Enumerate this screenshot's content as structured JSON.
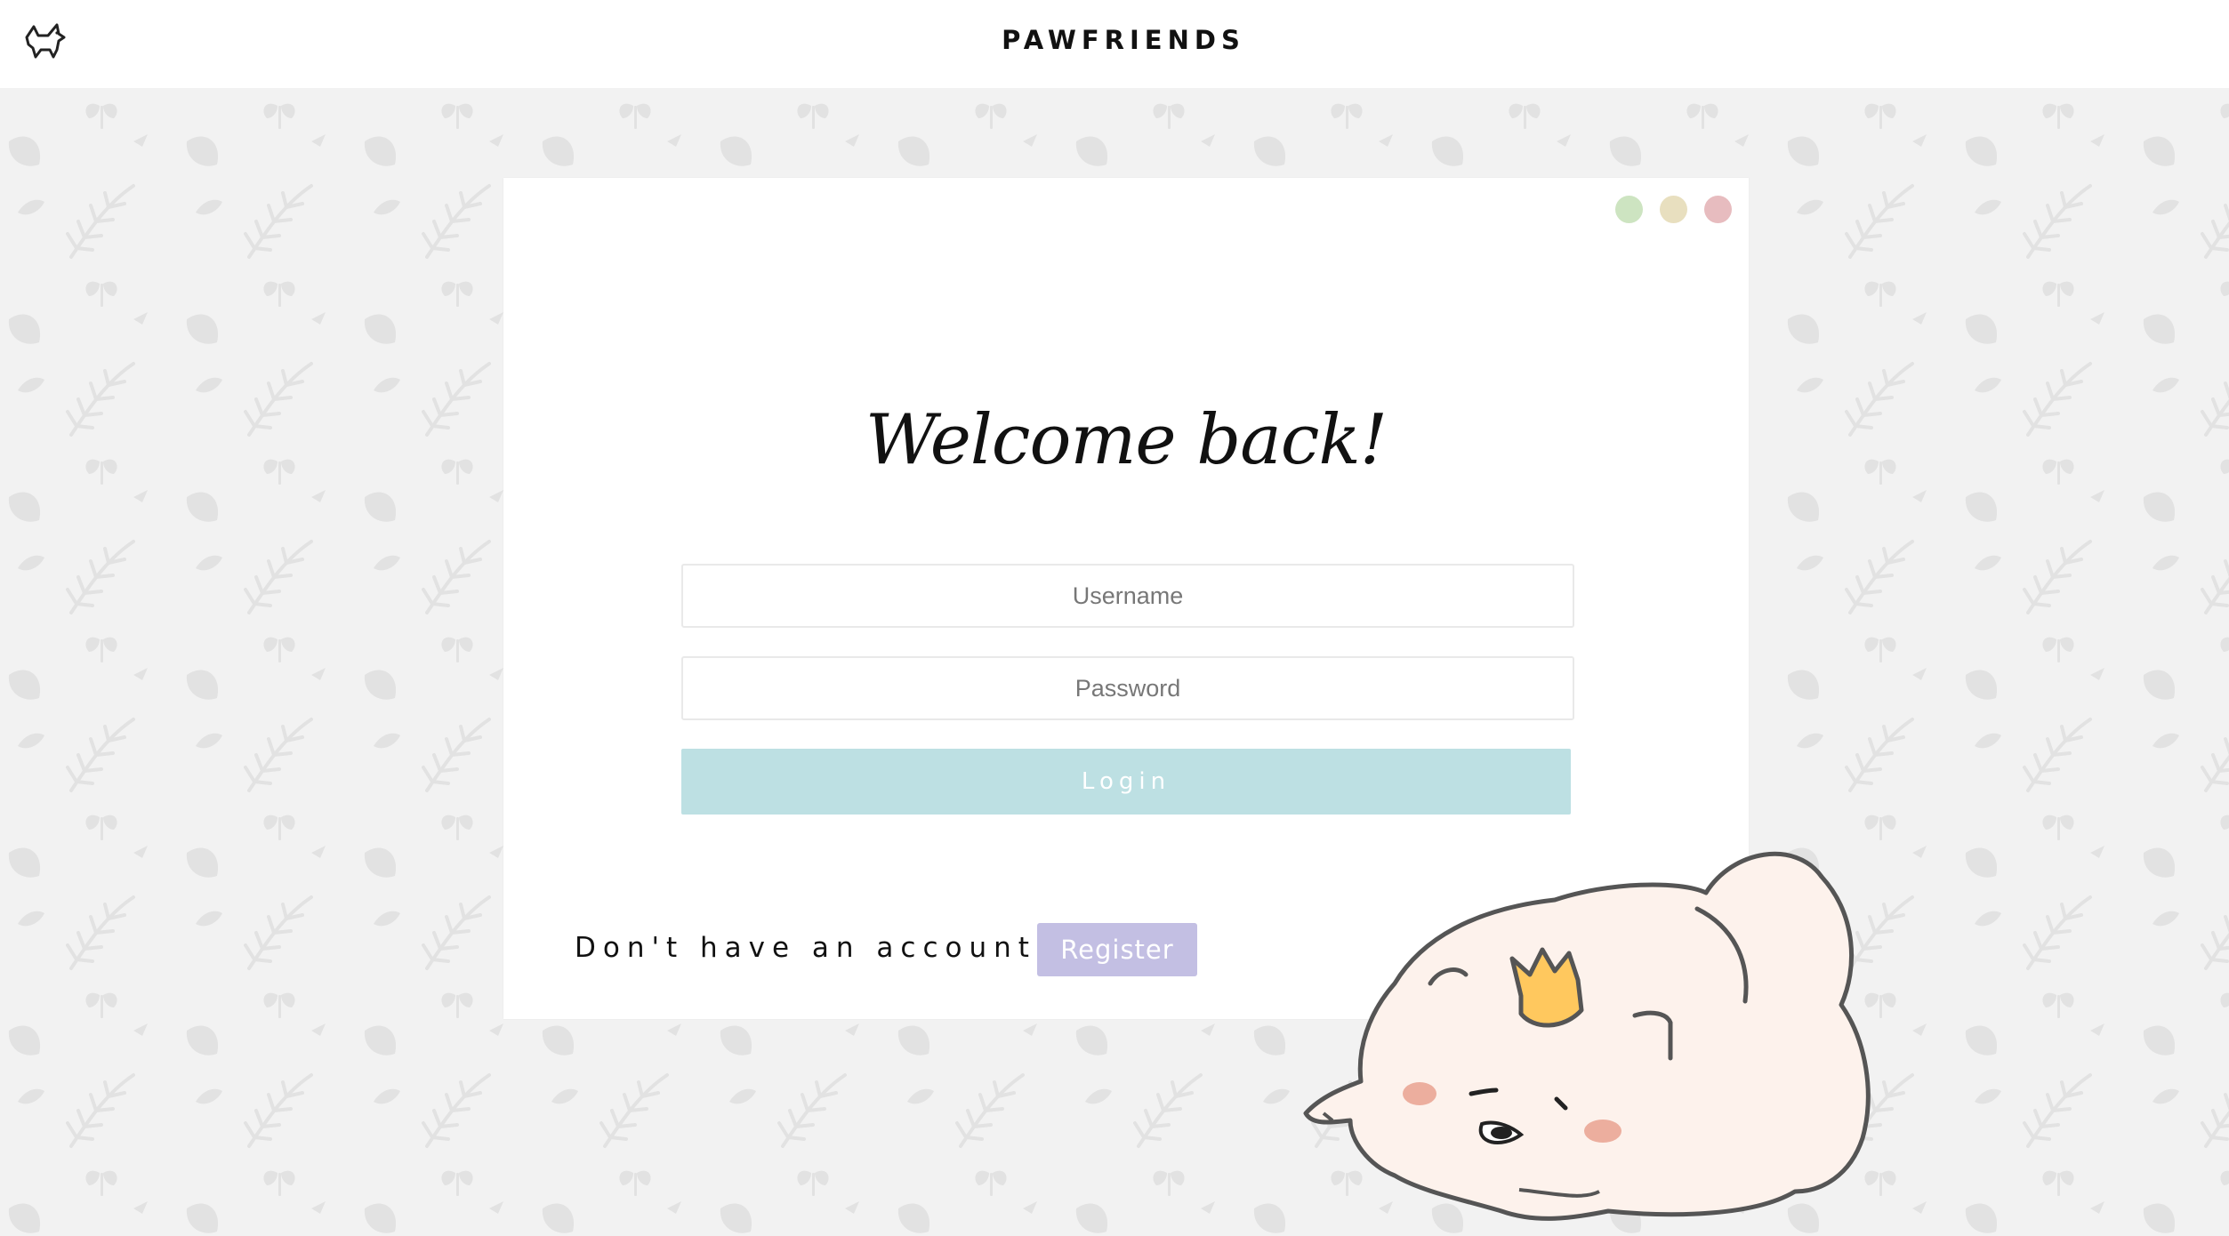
{
  "header": {
    "brand": "PAWFRIENDS",
    "logo_icon": "dog-outline-icon"
  },
  "window_controls": {
    "colors": [
      "#cde4c1",
      "#e8dfbf",
      "#e7bcbf"
    ],
    "icons": [
      "green-dot-icon",
      "yellow-dot-icon",
      "red-dot-icon"
    ]
  },
  "login": {
    "title": "Welcome back!",
    "username_placeholder": "Username",
    "password_placeholder": "Password",
    "login_label": "Login",
    "login_color": "#bde0e3"
  },
  "register": {
    "prompt": "Don't have an account?",
    "register_label": "Register",
    "register_color": "#c3bfe3"
  },
  "background": {
    "color": "#f2f2f2",
    "pattern": "leaf-pattern"
  },
  "illustration": {
    "name": "sleeping-hamster-with-crown"
  }
}
